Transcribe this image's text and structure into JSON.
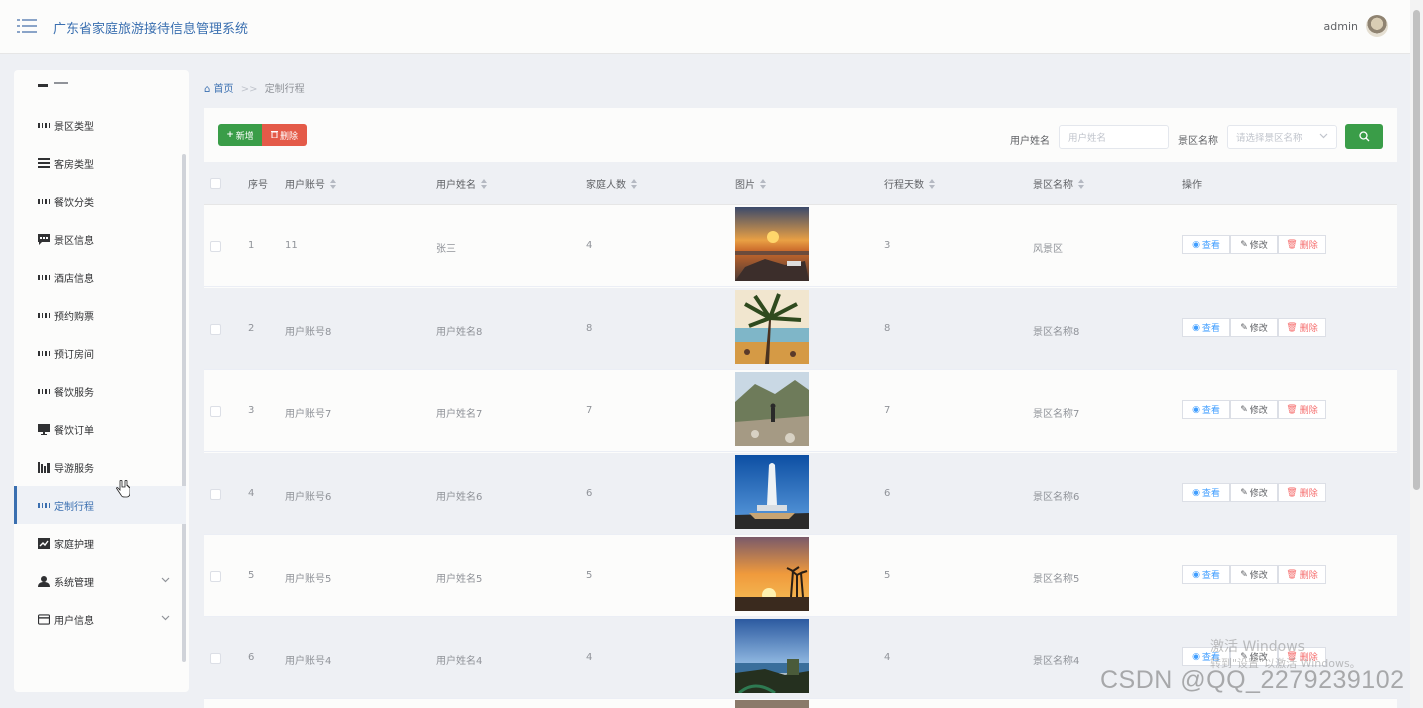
{
  "header": {
    "title": "广东省家庭旅游接待信息管理系统",
    "user": "admin"
  },
  "sidebar": {
    "items": [
      {
        "label": "景区类型",
        "icon": "grid-icon"
      },
      {
        "label": "客房类型",
        "icon": "list-icon"
      },
      {
        "label": "餐饮分类",
        "icon": "grid-icon"
      },
      {
        "label": "景区信息",
        "icon": "comment-icon"
      },
      {
        "label": "酒店信息",
        "icon": "grid-icon"
      },
      {
        "label": "预约购票",
        "icon": "grid-icon"
      },
      {
        "label": "预订房间",
        "icon": "grid-icon"
      },
      {
        "label": "餐饮服务",
        "icon": "grid-icon"
      },
      {
        "label": "餐饮订单",
        "icon": "monitor-icon"
      },
      {
        "label": "导游服务",
        "icon": "bar-chart-icon"
      },
      {
        "label": "定制行程",
        "icon": "grid-icon",
        "active": true
      },
      {
        "label": "家庭护理",
        "icon": "line-chart-icon"
      },
      {
        "label": "系统管理",
        "icon": "user-icon",
        "has_children": true
      },
      {
        "label": "用户信息",
        "icon": "card-icon",
        "has_children": true
      }
    ]
  },
  "breadcrumb": {
    "home": "首页",
    "separator": ">>",
    "current": "定制行程"
  },
  "toolbar": {
    "add_label": "新增",
    "delete_label": "删除",
    "username_label": "用户姓名",
    "username_placeholder": "用户姓名",
    "scenic_label": "景区名称",
    "scenic_placeholder": "请选择景区名称"
  },
  "table": {
    "columns": [
      "序号",
      "用户账号",
      "用户姓名",
      "家庭人数",
      "图片",
      "行程天数",
      "景区名称",
      "操作"
    ],
    "rows": [
      {
        "index": "1",
        "account": "11",
        "name": "张三",
        "family": "4",
        "days": "3",
        "scenic": "风景区",
        "image": "sunset-harbor"
      },
      {
        "index": "2",
        "account": "用户账号8",
        "name": "用户姓名8",
        "family": "8",
        "days": "8",
        "scenic": "景区名称8",
        "image": "palm-beach"
      },
      {
        "index": "3",
        "account": "用户账号7",
        "name": "用户姓名7",
        "family": "7",
        "days": "7",
        "scenic": "景区名称7",
        "image": "mountain-hiker"
      },
      {
        "index": "4",
        "account": "用户账号6",
        "name": "用户姓名6",
        "family": "6",
        "days": "6",
        "scenic": "景区名称6",
        "image": "guanyin-statue"
      },
      {
        "index": "5",
        "account": "用户账号5",
        "name": "用户姓名5",
        "family": "5",
        "days": "5",
        "scenic": "景区名称5",
        "image": "sunset-palms"
      },
      {
        "index": "6",
        "account": "用户账号4",
        "name": "用户姓名4",
        "family": "4",
        "days": "4",
        "scenic": "景区名称4",
        "image": "sea-cliff"
      }
    ],
    "actions": {
      "view": "查看",
      "edit": "修改",
      "delete": "删除"
    }
  },
  "watermarks": {
    "windows_line1": "激活 Windows",
    "windows_line2": "转到\"设置\"以激活 Windows。",
    "csdn": "CSDN @QQ_2279239102"
  },
  "colors": {
    "primary": "#3a6fb0",
    "success": "#3a9d48",
    "danger": "#e45a48"
  }
}
